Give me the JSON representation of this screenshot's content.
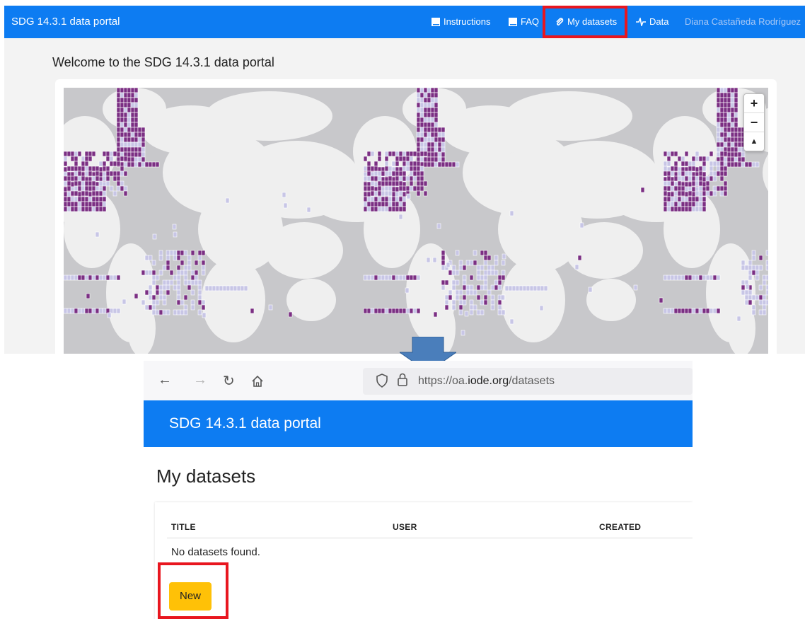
{
  "top": {
    "brand": "SDG 14.3.1 data portal",
    "nav": [
      {
        "label": "Instructions",
        "icon": "book-icon"
      },
      {
        "label": "FAQ",
        "icon": "book-icon"
      },
      {
        "label": "My datasets",
        "icon": "paperclip-icon"
      },
      {
        "label": "Data",
        "icon": "chart-icon"
      }
    ],
    "user": "Diana Castañeda Rodríguez",
    "welcome": "Welcome to the SDG 14.3.1 data portal",
    "map_controls": {
      "zoom_in": "+",
      "zoom_out": "−",
      "reset": "▲"
    }
  },
  "bottom": {
    "url_prefix": "https://oa.",
    "url_domain": "iode.org",
    "url_path": "/datasets",
    "brand": "SDG 14.3.1 data portal",
    "page_title": "My datasets",
    "columns": [
      "TITLE",
      "USER",
      "CREATED"
    ],
    "empty_message": "No datasets found.",
    "new_button": "New"
  },
  "colors": {
    "navbar": "#0d7cf2",
    "highlight": "#e8161f",
    "new_button": "#ffc107",
    "heat_dark": "#7b2f83",
    "heat_light": "#c8c6e6"
  }
}
